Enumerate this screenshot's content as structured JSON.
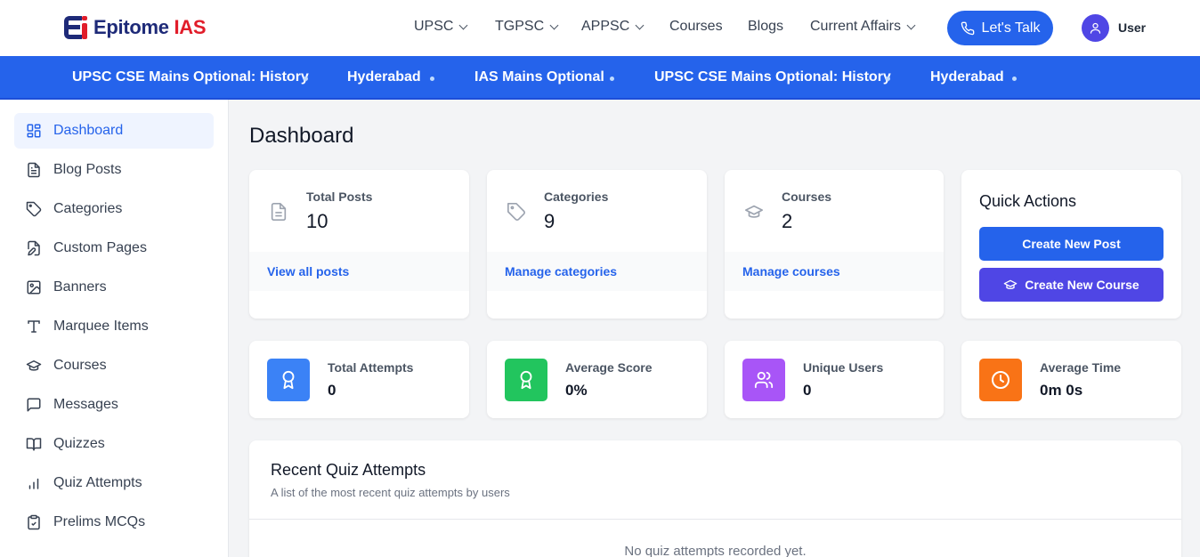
{
  "brand": {
    "name_part1": "Epitome",
    "name_part2": "IAS",
    "primary_color": "#1e2a78",
    "accent_color": "#e11d2a"
  },
  "header": {
    "nav": [
      {
        "label": "UPSC",
        "has_dropdown": true
      },
      {
        "label": "TGPSC",
        "has_dropdown": true
      },
      {
        "label": "APPSC",
        "has_dropdown": true
      },
      {
        "label": "Courses",
        "has_dropdown": false
      },
      {
        "label": "Blogs",
        "has_dropdown": false
      },
      {
        "label": "Current Affairs",
        "has_dropdown": true
      }
    ],
    "cta_label": "Let's Talk",
    "cta_icon": "phone-icon",
    "user_label": "User",
    "user_icon": "user-icon"
  },
  "marquee": {
    "background": "#2563eb",
    "items": [
      "UPSC CSE Mains Optional: History",
      "Hyderabad",
      "IAS Mains Optional",
      "UPSC CSE Mains Optional: History",
      "Hyderabad"
    ]
  },
  "sidebar": {
    "items": [
      {
        "label": "Dashboard",
        "icon": "dashboard-grid-icon",
        "active": true
      },
      {
        "label": "Blog Posts",
        "icon": "document-icon",
        "active": false
      },
      {
        "label": "Categories",
        "icon": "tag-icon",
        "active": false
      },
      {
        "label": "Custom Pages",
        "icon": "file-edit-icon",
        "active": false
      },
      {
        "label": "Banners",
        "icon": "image-icon",
        "active": false
      },
      {
        "label": "Marquee Items",
        "icon": "text-icon",
        "active": false
      },
      {
        "label": "Courses",
        "icon": "graduation-cap-icon",
        "active": false
      },
      {
        "label": "Messages",
        "icon": "message-icon",
        "active": false
      },
      {
        "label": "Quizzes",
        "icon": "book-open-icon",
        "active": false
      },
      {
        "label": "Quiz Attempts",
        "icon": "bar-chart-icon",
        "active": false
      },
      {
        "label": "Prelims MCQs",
        "icon": "clipboard-check-icon",
        "active": false
      }
    ]
  },
  "main": {
    "title": "Dashboard",
    "stats": [
      {
        "label": "Total Posts",
        "value": "10",
        "link": "View all posts",
        "icon": "document-icon"
      },
      {
        "label": "Categories",
        "value": "9",
        "link": "Manage categories",
        "icon": "tag-icon"
      },
      {
        "label": "Courses",
        "value": "2",
        "link": "Manage courses",
        "icon": "graduation-cap-icon"
      }
    ],
    "quick_actions": {
      "title": "Quick Actions",
      "create_post": "Create New Post",
      "create_course": "Create New Course",
      "post_color": "#2563eb",
      "course_color": "#4f46e5"
    },
    "quiz_stats": [
      {
        "label": "Total Attempts",
        "value": "0",
        "icon": "award-icon",
        "color": "#3b82f6"
      },
      {
        "label": "Average Score",
        "value": "0%",
        "icon": "award-icon",
        "color": "#22c55e"
      },
      {
        "label": "Unique Users",
        "value": "0",
        "icon": "users-icon",
        "color": "#a855f7"
      },
      {
        "label": "Average Time",
        "value": "0m 0s",
        "icon": "clock-icon",
        "color": "#f97316"
      }
    ],
    "recent": {
      "title": "Recent Quiz Attempts",
      "subtitle": "A list of the most recent quiz attempts by users",
      "empty": "No quiz attempts recorded yet."
    }
  }
}
